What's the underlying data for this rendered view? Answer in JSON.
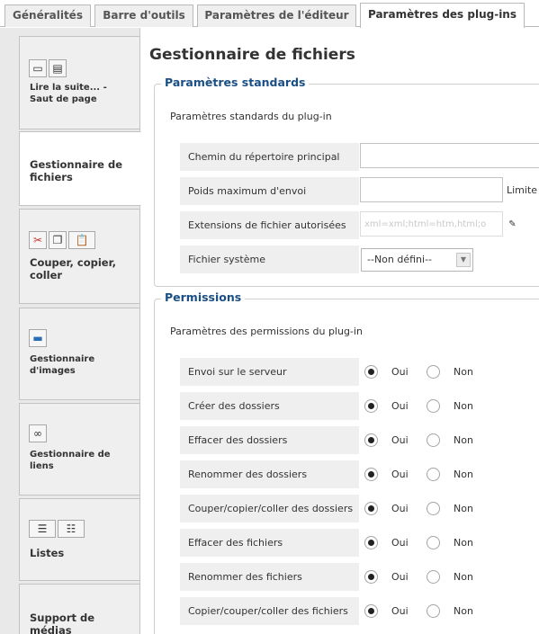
{
  "tabs": [
    {
      "label": "Généralités"
    },
    {
      "label": "Barre d'outils"
    },
    {
      "label": "Paramètres de l'éditeur"
    },
    {
      "label": "Paramètres des plug-ins"
    }
  ],
  "plugins": [
    {
      "label": "Lire la suite... - Saut de page"
    },
    {
      "label": "Gestionnaire de fichiers"
    },
    {
      "label": "Couper, copier, coller"
    },
    {
      "label": "Gestionnaire d'images"
    },
    {
      "label": "Gestionnaire de liens"
    },
    {
      "label": "Listes"
    },
    {
      "label": "Support de médias"
    }
  ],
  "page": {
    "title": "Gestionnaire de fichiers"
  },
  "standard": {
    "legend": "Paramètres standards",
    "description": "Paramètres standards du plug-in",
    "fields": [
      {
        "label": "Chemin du répertoire principal",
        "value": ""
      },
      {
        "label": "Poids maximum d'envoi",
        "value": "",
        "suffix": "Limite"
      },
      {
        "label": "Extensions de fichier autorisées",
        "value": "xml=xml;html=htm,html;o"
      },
      {
        "label": "Fichier système",
        "value": "--Non défini--"
      }
    ]
  },
  "permissions": {
    "legend": "Permissions",
    "description": "Paramètres des permissions du plug-in",
    "yes_label": "Oui",
    "no_label": "Non",
    "rows": [
      {
        "label": "Envoi sur le serveur",
        "selected": "Oui"
      },
      {
        "label": "Créer des dossiers",
        "selected": "Oui"
      },
      {
        "label": "Effacer des dossiers",
        "selected": "Oui"
      },
      {
        "label": "Renommer des dossiers",
        "selected": "Oui"
      },
      {
        "label": "Couper/copier/coller des dossiers",
        "selected": "Oui"
      },
      {
        "label": "Effacer des fichiers",
        "selected": "Oui"
      },
      {
        "label": "Renommer des fichiers",
        "selected": "Oui"
      },
      {
        "label": "Copier/couper/coller des fichiers",
        "selected": "Oui"
      }
    ]
  }
}
